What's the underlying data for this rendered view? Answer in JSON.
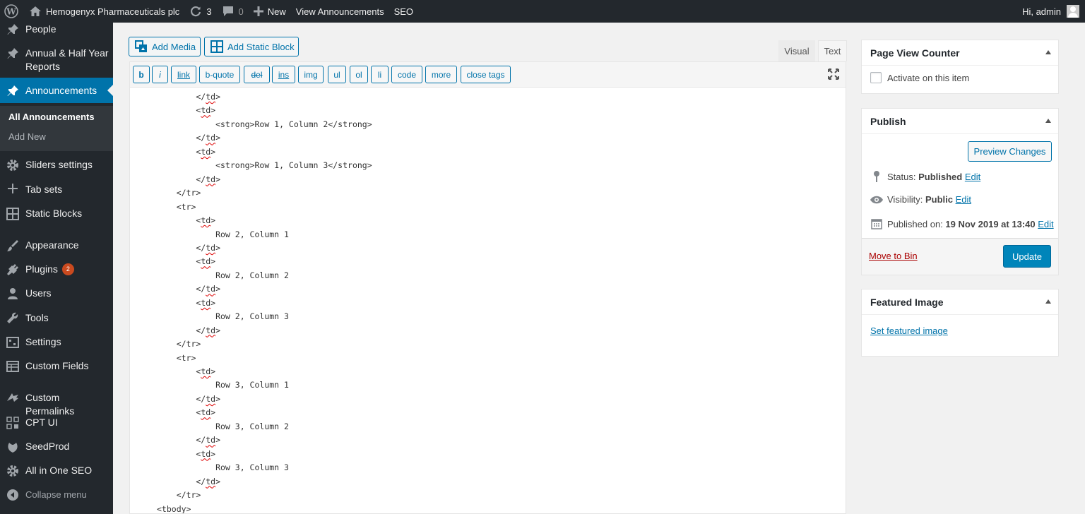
{
  "adminbar": {
    "site_name": "Hemogenyx Pharmaceuticals plc",
    "updates_count": "3",
    "comments_count": "0",
    "new_label": "New",
    "view_label": "View Announcements",
    "seo_label": "SEO",
    "greeting": "Hi, admin"
  },
  "sidebar": {
    "items": [
      {
        "label": "People",
        "icon": "pin-icon"
      },
      {
        "label": "Annual & Half Year Reports",
        "icon": "pin-icon"
      },
      {
        "label": "Announcements",
        "icon": "pin-icon"
      },
      {
        "label": "Sliders settings",
        "icon": "gear-icon"
      },
      {
        "label": "Tab sets",
        "icon": "plus-icon"
      },
      {
        "label": "Static Blocks",
        "icon": "grid-icon"
      },
      {
        "label": "Appearance",
        "icon": "brush-icon"
      },
      {
        "label": "Plugins",
        "icon": "plug-icon",
        "badge": "2"
      },
      {
        "label": "Users",
        "icon": "user-icon"
      },
      {
        "label": "Tools",
        "icon": "wrench-icon"
      },
      {
        "label": "Settings",
        "icon": "sliders-icon"
      },
      {
        "label": "Custom Fields",
        "icon": "table-icon"
      },
      {
        "label": "Custom Permalinks",
        "icon": "links-icon"
      },
      {
        "label": "CPT UI",
        "icon": "cpt-icon"
      },
      {
        "label": "SeedProd",
        "icon": "leaf-icon"
      },
      {
        "label": "All in One SEO",
        "icon": "gear-icon"
      }
    ],
    "submenu": [
      "All Announcements",
      "Add New"
    ],
    "collapse_label": "Collapse menu"
  },
  "editor": {
    "add_media": "Add Media",
    "add_static_block": "Add Static Block",
    "tab_visual": "Visual",
    "tab_text": "Text",
    "quicktags": [
      "b",
      "i",
      "link",
      "b-quote",
      "del",
      "ins",
      "img",
      "ul",
      "ol",
      "li",
      "code",
      "more",
      "close tags"
    ],
    "code_lines": [
      "        </td>",
      "        <td>",
      "            <strong>Row 1, Column 2</strong>",
      "        </td>",
      "        <td>",
      "            <strong>Row 1, Column 3</strong>",
      "        </td>",
      "    </tr>",
      "    <tr>",
      "        <td>",
      "            Row 2, Column 1",
      "        </td>",
      "        <td>",
      "            Row 2, Column 2",
      "        </td>",
      "        <td>",
      "            Row 2, Column 3",
      "        </td>",
      "    </tr>",
      "    <tr>",
      "        <td>",
      "            Row 3, Column 1",
      "        </td>",
      "        <td>",
      "            Row 3, Column 2",
      "        </td>",
      "        <td>",
      "            Row 3, Column 3",
      "        </td>",
      "    </tr>",
      "<tbody>"
    ]
  },
  "page_view_counter": {
    "title": "Page View Counter",
    "checkbox_label": "Activate on this item"
  },
  "publish": {
    "title": "Publish",
    "preview_label": "Preview Changes",
    "status_label": "Status:",
    "status_value": "Published",
    "visibility_label": "Visibility:",
    "visibility_value": "Public",
    "published_label": "Published on:",
    "published_value": "19 Nov 2019 at 13:40",
    "edit_label": "Edit",
    "move_to_bin": "Move to Bin",
    "update_label": "Update"
  },
  "featured_image": {
    "title": "Featured Image",
    "set_label": "Set featured image"
  },
  "colors": {
    "adminbar": "#23282d",
    "sidebar": "#23282d",
    "accent": "#0073aa",
    "badge": "#ca4a1f",
    "danger": "#a00"
  }
}
